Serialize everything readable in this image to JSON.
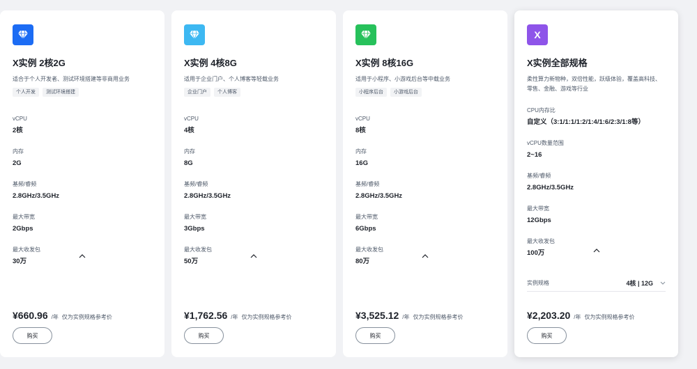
{
  "cards": [
    {
      "icon_color": "#1c6cf4",
      "icon_name": "diamond-icon",
      "title": "X实例 2核2G",
      "desc": "适合于个人开发者、测试环境搭建等非商用业务",
      "tags": [
        "个人开发",
        "测试环境搭建"
      ],
      "specs": [
        {
          "label": "vCPU",
          "value": "2核"
        },
        {
          "label": "内存",
          "value": "2G"
        },
        {
          "label": "基频/睿频",
          "value": "2.8GHz/3.5GHz"
        },
        {
          "label": "最大带宽",
          "value": "2Gbps"
        },
        {
          "label": "最大收发包",
          "value": "30万"
        }
      ],
      "price": "¥660.96",
      "unit": "/年",
      "note": "仅为实例规格参考价",
      "buy": "购买"
    },
    {
      "icon_color": "#3db8f2",
      "icon_name": "diamond-icon",
      "title": "X实例 4核8G",
      "desc": "适用于企业门户、个人博客等轻载业务",
      "tags": [
        "企业门户",
        "个人博客"
      ],
      "specs": [
        {
          "label": "vCPU",
          "value": "4核"
        },
        {
          "label": "内存",
          "value": "8G"
        },
        {
          "label": "基频/睿频",
          "value": "2.8GHz/3.5GHz"
        },
        {
          "label": "最大带宽",
          "value": "3Gbps"
        },
        {
          "label": "最大收发包",
          "value": "50万"
        }
      ],
      "price": "¥1,762.56",
      "unit": "/年",
      "note": "仅为实例规格参考价",
      "buy": "购买"
    },
    {
      "icon_color": "#27c15b",
      "icon_name": "diamond-icon",
      "title": "X实例 8核16G",
      "desc": "适用于小程序、小游戏后台等中载业务",
      "tags": [
        "小程序后台",
        "小游戏后台"
      ],
      "specs": [
        {
          "label": "vCPU",
          "value": "8核"
        },
        {
          "label": "内存",
          "value": "16G"
        },
        {
          "label": "基频/睿频",
          "value": "2.8GHz/3.5GHz"
        },
        {
          "label": "最大带宽",
          "value": "6Gbps"
        },
        {
          "label": "最大收发包",
          "value": "80万"
        }
      ],
      "price": "¥3,525.12",
      "unit": "/年",
      "note": "仅为实例规格参考价",
      "buy": "购买"
    },
    {
      "icon_color": "#8e54e9",
      "icon_letter": "X",
      "title": "X实例全部规格",
      "desc": "柔性算力新物种，双倍性能，跃级体验，覆盖高科技、零售、金融、游戏等行业",
      "specs": [
        {
          "label": "CPU内存比",
          "value": "自定义（3:1/1:1/1:2/1:4/1:6/2:3/1:8等）"
        },
        {
          "label": "vCPU数量范围",
          "value": "2~16"
        },
        {
          "label": "基频/睿频",
          "value": "2.8GHz/3.5GHz"
        },
        {
          "label": "最大带宽",
          "value": "12Gbps"
        },
        {
          "label": "最大收发包",
          "value": "100万"
        }
      ],
      "select_label": "实例规格",
      "select_value": "4核 | 12G",
      "price": "¥2,203.20",
      "unit": "/年",
      "note": "仅为实例规格参考价",
      "buy": "购买"
    }
  ]
}
